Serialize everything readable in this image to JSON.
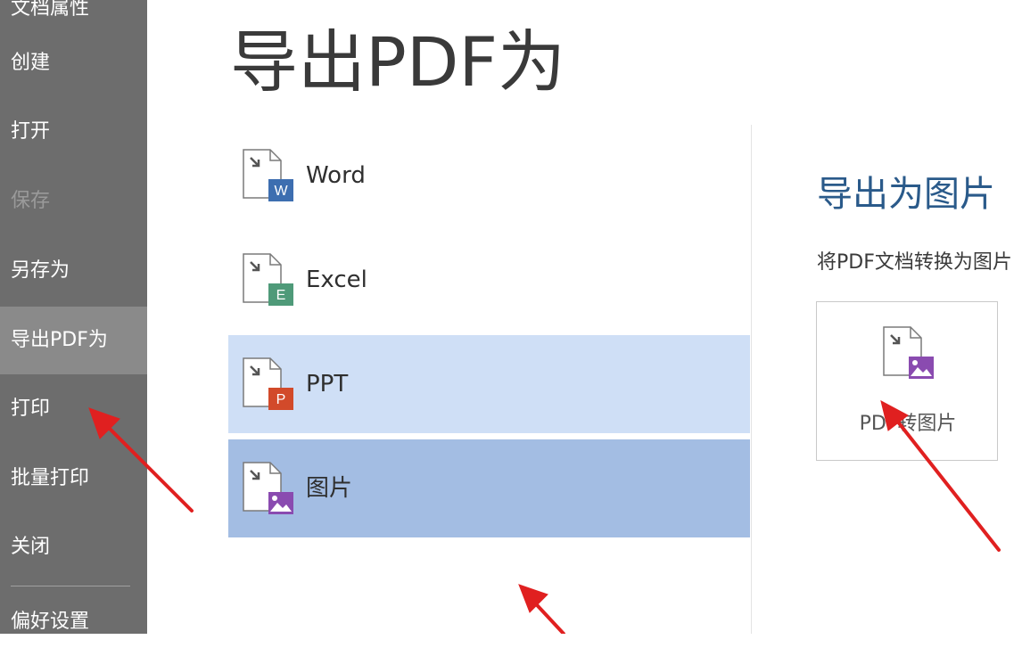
{
  "sidebar": {
    "items": [
      {
        "label": "文档属性"
      },
      {
        "label": "创建"
      },
      {
        "label": "打开"
      },
      {
        "label": "保存"
      },
      {
        "label": "另存为"
      },
      {
        "label": "导出PDF为"
      },
      {
        "label": "打印"
      },
      {
        "label": "批量打印"
      },
      {
        "label": "关闭"
      },
      {
        "label": "偏好设置"
      }
    ]
  },
  "main": {
    "title": "导出PDF为",
    "formats": [
      {
        "label": "Word",
        "badge": "W",
        "badge_color": "#3d6eb0"
      },
      {
        "label": "Excel",
        "badge": "E",
        "badge_color": "#4f9a79"
      },
      {
        "label": "PPT",
        "badge": "P",
        "badge_color": "#d24a2a"
      },
      {
        "label": "图片",
        "badge": "image-icon",
        "badge_color": "#8a4bb0"
      }
    ]
  },
  "right_panel": {
    "title": "导出为图片",
    "description": "将PDF文档转换为图片",
    "tile_label": "PDF转图片"
  },
  "colors": {
    "sidebar_bg": "#6d6d6d",
    "sidebar_active": "#8a8a8a",
    "row_hover": "#cfdff6",
    "row_selected": "#a3bde3",
    "accent_title": "#2a5a8a",
    "annotation_arrow": "#e02020"
  }
}
